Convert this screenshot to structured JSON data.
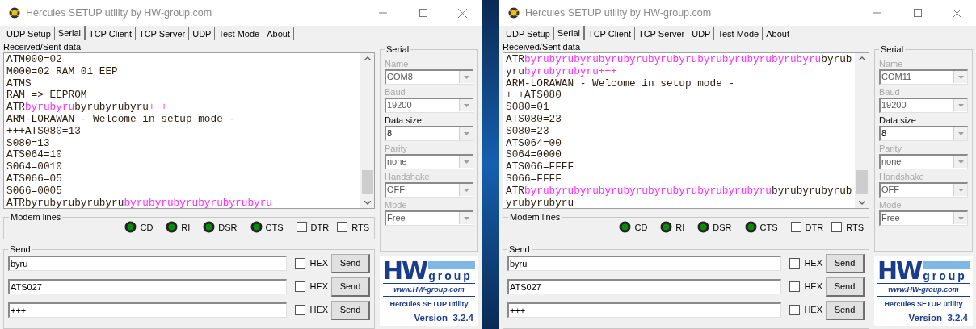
{
  "windows": [
    {
      "title": "Hercules SETUP utility by HW-group.com",
      "tabs": [
        {
          "label": "UDP Setup",
          "selected": false
        },
        {
          "label": "Serial",
          "selected": true
        },
        {
          "label": "TCP Client",
          "selected": false
        },
        {
          "label": "TCP Server",
          "selected": false
        },
        {
          "label": "UDP",
          "selected": false
        },
        {
          "label": "Test Mode",
          "selected": false
        },
        {
          "label": "About",
          "selected": false
        }
      ],
      "data_label": "Received/Sent data",
      "lines": [
        {
          "segments": [
            {
              "text": "ATM000=02",
              "sent": false
            }
          ]
        },
        {
          "segments": [
            {
              "text": "M000=02 RAM 01 EEP",
              "sent": false
            }
          ]
        },
        {
          "segments": [
            {
              "text": "ATMS",
              "sent": false
            }
          ]
        },
        {
          "segments": [
            {
              "text": "RAM => EEPROM",
              "sent": false
            }
          ]
        },
        {
          "segments": [
            {
              "text": "ATR",
              "sent": false
            },
            {
              "text": "byrubyru",
              "sent": true
            },
            {
              "text": "byrubyrubyru",
              "sent": false
            },
            {
              "text": "+++",
              "sent": true
            }
          ]
        },
        {
          "segments": [
            {
              "text": "ARM-LORAWAN - Welcome in setup mode -",
              "sent": false
            }
          ]
        },
        {
          "segments": [
            {
              "text": "+++ATS080=13",
              "sent": false
            }
          ]
        },
        {
          "segments": [
            {
              "text": "S080=13",
              "sent": false
            }
          ]
        },
        {
          "segments": [
            {
              "text": "ATS064=10",
              "sent": false
            }
          ]
        },
        {
          "segments": [
            {
              "text": "S064=0010",
              "sent": false
            }
          ]
        },
        {
          "segments": [
            {
              "text": "ATS066=05",
              "sent": false
            }
          ]
        },
        {
          "segments": [
            {
              "text": "S066=0005",
              "sent": false
            }
          ]
        },
        {
          "segments": [
            {
              "text": "ATRbyrubyrubyrubyru",
              "sent": false
            },
            {
              "text": "byrubyrubyrubyrubyrubyru",
              "sent": true
            }
          ]
        }
      ],
      "modem_legend": "Modem lines",
      "leds": [
        {
          "label": "CD",
          "lit": true
        },
        {
          "label": "RI",
          "lit": true
        },
        {
          "label": "DSR",
          "lit": true
        },
        {
          "label": "CTS",
          "lit": true
        }
      ],
      "modem_checks": [
        {
          "label": "DTR",
          "checked": false
        },
        {
          "label": "RTS",
          "checked": false
        }
      ],
      "send_legend": "Send",
      "send_rows": [
        {
          "value": "byru",
          "hex_label": "HEX",
          "hex_checked": false,
          "button": "Send"
        },
        {
          "value": "ATS027",
          "hex_label": "HEX",
          "hex_checked": false,
          "button": "Send"
        },
        {
          "value": "+++",
          "hex_label": "HEX",
          "hex_checked": false,
          "button": "Send"
        }
      ],
      "serial_legend": "Serial",
      "serial_fields": [
        {
          "label": "Name",
          "value": "COM8",
          "disabled": true
        },
        {
          "label": "Baud",
          "value": "19200",
          "disabled": true
        },
        {
          "label": "Data size",
          "value": "8",
          "disabled": false
        },
        {
          "label": "Parity",
          "value": "none",
          "disabled": true
        },
        {
          "label": "Handshake",
          "value": "OFF",
          "disabled": true
        },
        {
          "label": "Mode",
          "value": "Free",
          "disabled": true
        }
      ],
      "logo": {
        "big": "HW",
        "word": "group",
        "url": "www.HW-group.com",
        "product": "Hercules SETUP utility",
        "version": "Version  3.2.4"
      }
    },
    {
      "title": "Hercules SETUP utility by HW-group.com",
      "tabs": [
        {
          "label": "UDP Setup",
          "selected": false
        },
        {
          "label": "Serial",
          "selected": true
        },
        {
          "label": "TCP Client",
          "selected": false
        },
        {
          "label": "TCP Server",
          "selected": false
        },
        {
          "label": "UDP",
          "selected": false
        },
        {
          "label": "Test Mode",
          "selected": false
        },
        {
          "label": "About",
          "selected": false
        }
      ],
      "data_label": "Received/Sent data",
      "lines": [
        {
          "segments": [
            {
              "text": "ATR",
              "sent": false
            },
            {
              "text": "byrubyrubyrubyrubyrubyrubyrubyrubyrubyrubyrubyru",
              "sent": true
            },
            {
              "text": "byrub",
              "sent": false
            }
          ]
        },
        {
          "segments": [
            {
              "text": "yru",
              "sent": false
            },
            {
              "text": "byrubyrubyru+++",
              "sent": true
            }
          ]
        },
        {
          "segments": [
            {
              "text": "ARM-LORAWAN - Welcome in setup mode -",
              "sent": false
            }
          ]
        },
        {
          "segments": [
            {
              "text": "+++ATS080",
              "sent": false
            }
          ]
        },
        {
          "segments": [
            {
              "text": "S080=01",
              "sent": false
            }
          ]
        },
        {
          "segments": [
            {
              "text": "ATS080=23",
              "sent": false
            }
          ]
        },
        {
          "segments": [
            {
              "text": "S080=23",
              "sent": false
            }
          ]
        },
        {
          "segments": [
            {
              "text": "ATS064=00",
              "sent": false
            }
          ]
        },
        {
          "segments": [
            {
              "text": "S064=0000",
              "sent": false
            }
          ]
        },
        {
          "segments": [
            {
              "text": "ATS066=FFFF",
              "sent": false
            }
          ]
        },
        {
          "segments": [
            {
              "text": "S066=FFFF",
              "sent": false
            }
          ]
        },
        {
          "segments": [
            {
              "text": "ATR",
              "sent": false
            },
            {
              "text": "byrubyrubyrubyrubyrubyrubyrubyrubyrubyru",
              "sent": true
            },
            {
              "text": "byrubyrubyrub",
              "sent": false
            }
          ]
        },
        {
          "segments": [
            {
              "text": "yrubyrubyru",
              "sent": false
            }
          ]
        }
      ],
      "modem_legend": "Modem lines",
      "leds": [
        {
          "label": "CD",
          "lit": true
        },
        {
          "label": "RI",
          "lit": true
        },
        {
          "label": "DSR",
          "lit": true
        },
        {
          "label": "CTS",
          "lit": true
        }
      ],
      "modem_checks": [
        {
          "label": "DTR",
          "checked": false
        },
        {
          "label": "RTS",
          "checked": false
        }
      ],
      "send_legend": "Send",
      "send_rows": [
        {
          "value": "byru",
          "hex_label": "HEX",
          "hex_checked": false,
          "button": "Send"
        },
        {
          "value": "ATS027",
          "hex_label": "HEX",
          "hex_checked": false,
          "button": "Send"
        },
        {
          "value": "+++",
          "hex_label": "HEX",
          "hex_checked": false,
          "button": "Send"
        }
      ],
      "serial_legend": "Serial",
      "serial_fields": [
        {
          "label": "Name",
          "value": "COM11",
          "disabled": true
        },
        {
          "label": "Baud",
          "value": "19200",
          "disabled": true
        },
        {
          "label": "Data size",
          "value": "8",
          "disabled": false
        },
        {
          "label": "Parity",
          "value": "none",
          "disabled": true
        },
        {
          "label": "Handshake",
          "value": "OFF",
          "disabled": true
        },
        {
          "label": "Mode",
          "value": "Free",
          "disabled": true
        }
      ],
      "logo": {
        "big": "HW",
        "word": "group",
        "url": "www.HW-group.com",
        "product": "Hercules SETUP utility",
        "version": "Version  3.2.4"
      }
    }
  ]
}
